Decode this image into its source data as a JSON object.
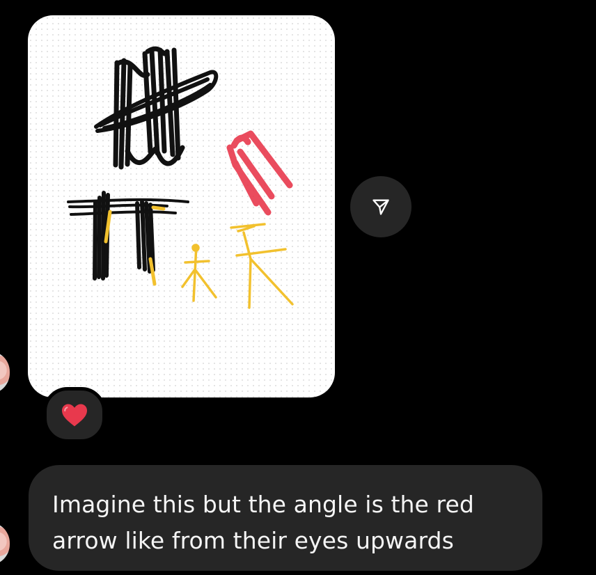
{
  "conversation": {
    "messages": [
      {
        "type": "image",
        "content": "sketch drawing",
        "reactions": [
          {
            "emoji": "❤️",
            "icon": "heart-reaction-icon"
          }
        ]
      },
      {
        "type": "text",
        "text": "Imagine this but the angle is the red arrow like from their eyes upwards"
      }
    ]
  },
  "actions": {
    "share_icon": "send-paper-plane-icon"
  },
  "colors": {
    "background": "#000000",
    "bubble": "#262626",
    "text": "#f5f5f5",
    "arrow_red": "#e8394d",
    "figure_yellow": "#f2c12e"
  }
}
